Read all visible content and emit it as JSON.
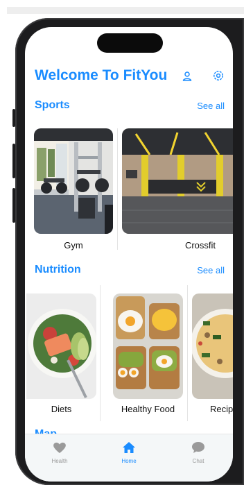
{
  "app": {
    "title": "Welcome To FitYou",
    "header_icons": [
      "person-icon",
      "settings-icon"
    ]
  },
  "sports": {
    "heading": "Sports",
    "see_all": "See all",
    "items": [
      {
        "label": "Gym",
        "image": "gym-photo"
      },
      {
        "label": "Crossfit",
        "image": "crossfit-photo"
      }
    ]
  },
  "nutrition": {
    "heading": "Nutrition",
    "see_all": "See all",
    "items": [
      {
        "label": "Diets",
        "image": "salmon-salad-photo"
      },
      {
        "label": "Healthy Food",
        "image": "eggs-avocado-toast-photo"
      },
      {
        "label": "Recip",
        "image": "pasta-photo"
      }
    ]
  },
  "next_section": {
    "heading": "Map"
  },
  "tabbar": {
    "tabs": [
      {
        "label": "Health",
        "icon": "heart-icon",
        "active": false
      },
      {
        "label": "Home",
        "icon": "home-icon",
        "active": true
      },
      {
        "label": "Chat",
        "icon": "chat-bubble-icon",
        "active": false
      }
    ]
  },
  "colors": {
    "accent": "#1a8cff",
    "inactive": "#9a9a9a",
    "tabbar_bg": "#f4f7f8"
  }
}
